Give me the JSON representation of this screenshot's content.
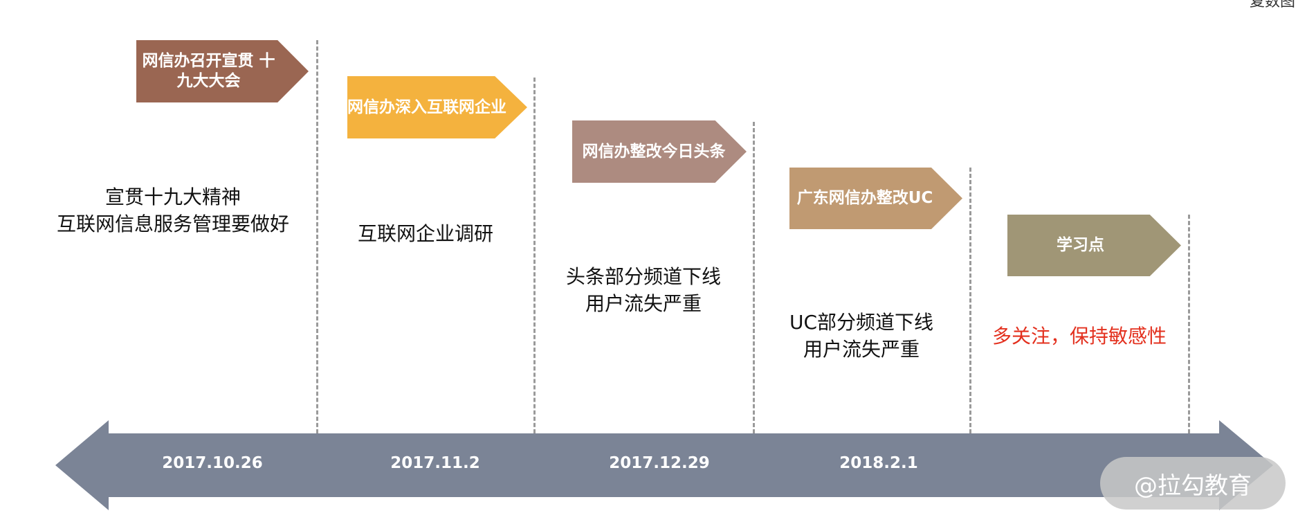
{
  "corner_text": "复数图",
  "colors": {
    "arrow": "#7b8496",
    "tag1": "#9a6652",
    "tag2": "#f4b23e",
    "tag3": "#ad8b80",
    "tag4": "#c09a72",
    "tag5": "#a09676",
    "highlight_text": "#e3301e",
    "divider": "#9a9a9a"
  },
  "milestones": [
    {
      "tag": "网信办召开宣贯\n十九大大会",
      "description": "宣贯十九大精神\n互联网信息服务管理要做好",
      "date": "2017.10.26"
    },
    {
      "tag": "网信办深入互联网企业",
      "description": "互联网企业调研",
      "date": "2017.11.2"
    },
    {
      "tag": "网信办整改今日头条",
      "description": "头条部分频道下线\n用户流失严重",
      "date": "2017.12.29"
    },
    {
      "tag": "广东网信办整改UC",
      "description": "UC部分频道下线\n用户流失严重",
      "date": "2018.2.1"
    },
    {
      "tag": "学习点",
      "description": "多关注，保持敏感性",
      "date": ""
    }
  ],
  "watermark": "@拉勾教育"
}
